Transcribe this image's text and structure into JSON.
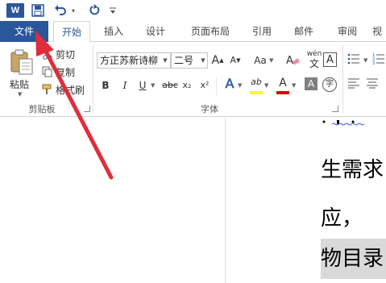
{
  "quick_access": {
    "app_logo_letter": "W",
    "icons": [
      "word-logo",
      "save-icon",
      "undo-icon",
      "redo-icon",
      "customize-icon"
    ]
  },
  "tabs": [
    {
      "label": "文件"
    },
    {
      "label": "开始"
    },
    {
      "label": "插入"
    },
    {
      "label": "设计"
    },
    {
      "label": "页面布局"
    },
    {
      "label": "引用"
    },
    {
      "label": "邮件"
    },
    {
      "label": "审阅"
    },
    {
      "label": "视"
    }
  ],
  "clipboard": {
    "paste_label": "粘贴",
    "cut_label": "剪切",
    "copy_label": "复制",
    "format_painter_label": "格式刷",
    "group_label": "剪贴板"
  },
  "font": {
    "font_name": "方正苏新诗柳",
    "font_size": "二号",
    "grow_label": "A",
    "shrink_label": "A",
    "case_label": "Aa",
    "clear_format_label": "A",
    "pinyin_label": "wén",
    "border_char_label": "A",
    "bold_label": "B",
    "italic_label": "I",
    "underline_label": "U",
    "strike_label": "abc",
    "subscript_label": "x₂",
    "superscript_label": "x²",
    "effects_label": "A",
    "highlight_label": "ab",
    "color_label": "A",
    "shading_label": "A",
    "enclose_label": "字",
    "group_label": "字体"
  },
  "document": {
    "line1": "生需求",
    "line2": "应，",
    "line3": "物目录"
  },
  "colors": {
    "brand_blue": "#2b579a",
    "annotation_red": "#e02d3c",
    "highlight_yellow": "#ffff00",
    "font_color_red": "#e00000"
  }
}
